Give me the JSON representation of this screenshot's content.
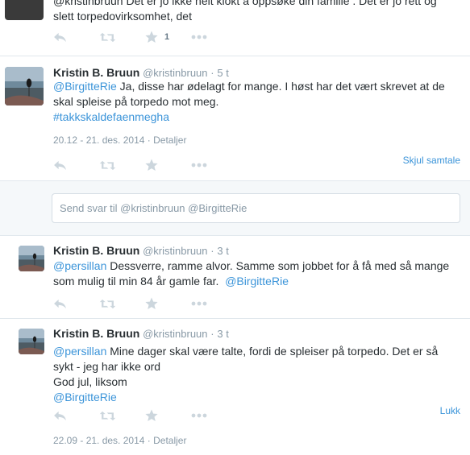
{
  "tweet1": {
    "text_line1": "@kristinbruun  Det er jo ikke helt klokt å oppsøke din familie . Det er jo rett og",
    "text_line2": "slett torpedovirksomhet, det",
    "favorite_count": "1"
  },
  "tweet2": {
    "name": "Kristin B. Bruun",
    "handle": "@kristinbruun",
    "time": "5 t",
    "mention": "@BirgitteRie",
    "text_a": " Ja, disse har ødelagt for mange. I høst har det vært skrevet at de",
    "text_b": "skal spleise på torpedo mot meg.",
    "hashtag": "#takkskaldefaenmegha",
    "date": "20.12 - 21. des. 2014",
    "details": "Detaljer",
    "hide_conversation": "Skjul samtale"
  },
  "reply": {
    "placeholder": "Send svar til @kristinbruun @BirgitteRie"
  },
  "tweet3": {
    "name": "Kristin B. Bruun",
    "handle": "@kristinbruun",
    "time": "3 t",
    "mention": "@persillan",
    "text_a": " Dessverre, ramme alvor. Samme som jobbet for å få med så mange",
    "text_b": "som mulig til min 84 år gamle far.",
    "mention2": "@BirgitteRie"
  },
  "tweet4": {
    "name": "Kristin B. Bruun",
    "handle": "@kristinbruun",
    "time": "3 t",
    "mention": "@persillan",
    "text_a": " Mine dager skal være talte, fordi de spleiser på torpedo. Det er så",
    "text_b": "sykt - jeg har ikke ord",
    "text_c": "God jul, liksom",
    "mention2": "@BirgitteRie",
    "close": "Lukk",
    "date": "22.09 - 21. des. 2014",
    "details": "Detaljer"
  },
  "separator": "·",
  "icons": [
    "reply-icon",
    "retweet-icon",
    "favorite-icon",
    "more-icon"
  ],
  "colors": {
    "link": "#3b94d9",
    "muted": "#8899a6",
    "icon": "#ccd6dd",
    "border": "#e1e8ed"
  }
}
